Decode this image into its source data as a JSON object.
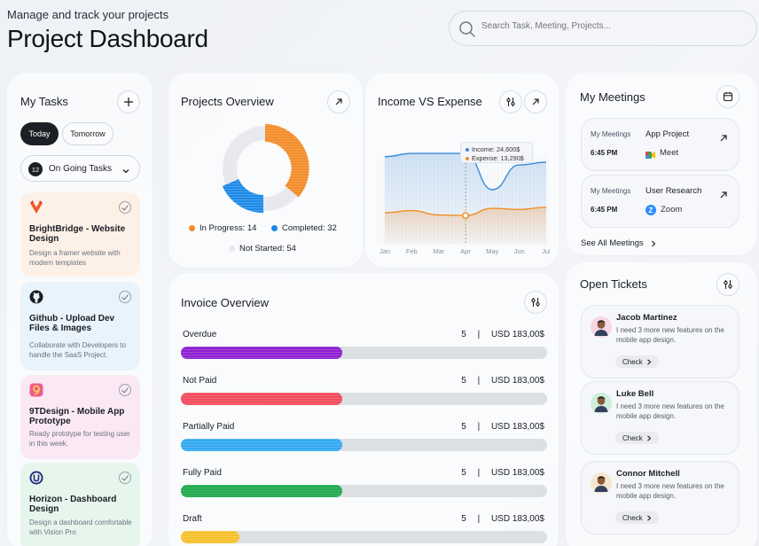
{
  "header": {
    "subtitle": "Manage and track your projects",
    "title": "Project Dashboard",
    "search_placeholder": "Search Task, Meeting, Projects..."
  },
  "my_tasks": {
    "title": "My Tasks",
    "tabs": [
      "Today",
      "Tomorrow"
    ],
    "filter": {
      "count": "12",
      "label": "On Going Tasks"
    },
    "items": [
      {
        "icon": "brightbridge-logo-icon",
        "title": "BrightBridge - Website Design",
        "desc": "Design a framer website with modern templates",
        "color": "#fff2e8"
      },
      {
        "icon": "github-icon",
        "title": "Github - Upload Dev Files & Images",
        "desc": "Collaborate with Developers to handle the SaaS Project.",
        "color": "#eaf4fc"
      },
      {
        "icon": "9tdesign-logo-icon",
        "title": "9TDesign - Mobile App Prototype",
        "desc": "Ready prototype for testing user in this week.",
        "color": "#fce9f6"
      },
      {
        "icon": "horizon-logo-icon",
        "title": "Horizon - Dashboard Design",
        "desc": "Design a dashboard comfortable with Vision Pro",
        "color": "#e8f7ee"
      }
    ]
  },
  "projects_overview": {
    "title": "Projects Overview",
    "legend": [
      {
        "label": "In Progress: 14",
        "color": "#f28c28"
      },
      {
        "label": "Completed: 32",
        "color": "#1e88e5"
      },
      {
        "label": "Not Started: 54",
        "color": "#e7e9ee"
      }
    ]
  },
  "chart_data": {
    "type": "line",
    "title": "Income VS Expense",
    "categories": [
      "Jan",
      "Feb",
      "Mar",
      "Apr",
      "May",
      "Jun",
      "Jul"
    ],
    "series": [
      {
        "name": "Income",
        "values": [
          24000,
          24600,
          24600,
          24600,
          18000,
          22500,
          23000
        ],
        "color": "#3b8ad9"
      },
      {
        "name": "Expense",
        "values": [
          13800,
          14200,
          13400,
          13290,
          14600,
          14400,
          14800
        ],
        "color": "#f28c28"
      }
    ],
    "tooltip": {
      "income": "Income: 24,600$",
      "expense": "Expense: 13,290$"
    }
  },
  "invoice_overview": {
    "title": "Invoice Overview",
    "rows": [
      {
        "label": "Overdue",
        "count": "5",
        "amount": "USD 183,00$",
        "fill": 0.44,
        "color": "#8d1fd1"
      },
      {
        "label": "Not Paid",
        "count": "5",
        "amount": "USD 183,00$",
        "fill": 0.44,
        "color": "#f24b5a"
      },
      {
        "label": "Partially Paid",
        "count": "5",
        "amount": "USD 183,00$",
        "fill": 0.44,
        "color": "#33a8f0"
      },
      {
        "label": "Fully Paid",
        "count": "5",
        "amount": "USD 183,00$",
        "fill": 0.44,
        "color": "#1faa4d"
      },
      {
        "label": "Draft",
        "count": "5",
        "amount": "USD 183,00$",
        "fill": 0.16,
        "color": "#f7c02b"
      }
    ],
    "separator": "|"
  },
  "meetings": {
    "title": "My Meetings",
    "items": [
      {
        "label": "My Meetings",
        "title": "App Project",
        "time": "6:45 PM",
        "app": "Meet",
        "app_icon": "google-meet-icon"
      },
      {
        "label": "My Meetings",
        "title": "User Research",
        "time": "6:45 PM",
        "app": "Zoom",
        "app_icon": "zoom-icon"
      }
    ],
    "see_all": "See All Meetings"
  },
  "tickets": {
    "title": "Open Tickets",
    "items": [
      {
        "name": "Jacob Martinez",
        "text": "I need 3 more new features on the mobile app design.",
        "button": "Check",
        "avatar_bg": "#f7d6e6"
      },
      {
        "name": "Luke Bell",
        "text": "I need 3 more new features on the mobile app design.",
        "button": "Check",
        "avatar_bg": "#cdeed9"
      },
      {
        "name": "Connor Mitchell",
        "text": "I need 3 more new features on the mobile app design.",
        "button": "Check",
        "avatar_bg": "#f5e6cf"
      }
    ]
  }
}
